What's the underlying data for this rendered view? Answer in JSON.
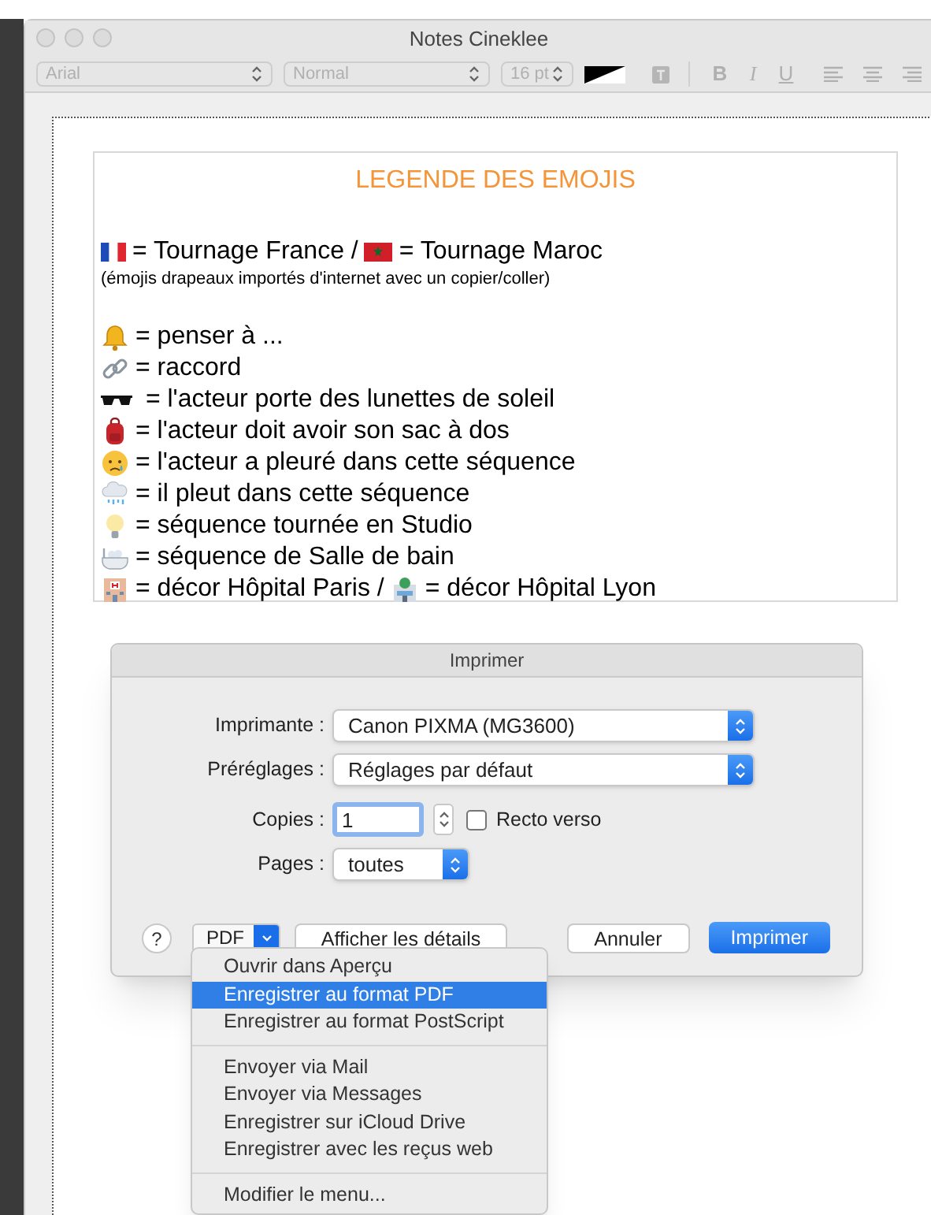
{
  "window": {
    "title": "Notes Cineklee"
  },
  "toolbar": {
    "disabled": true,
    "font": "Arial",
    "style": "Normal",
    "size": "16 pt",
    "buttons": [
      {
        "kind": "bold",
        "label": "B"
      },
      {
        "kind": "italic",
        "label": "I"
      },
      {
        "kind": "underline",
        "label": "U"
      }
    ]
  },
  "legend": {
    "title": "LEGENDE DES EMOJIS",
    "lines": [
      {
        "kind": "big",
        "segments": [
          "= Tournage France /",
          "= Tournage Maroc"
        ]
      },
      {
        "kind": "note",
        "segments": [
          "(émojis drapeaux importés d'internet avec un copier/coller)"
        ]
      },
      {
        "kind": "big",
        "segments": [
          "= penser à ..."
        ]
      },
      {
        "kind": "big",
        "segments": [
          "= raccord"
        ]
      },
      {
        "kind": "big",
        "segments": [
          " = l'acteur porte des lunettes de soleil"
        ]
      },
      {
        "kind": "big",
        "segments": [
          "= l'acteur doit avoir son sac à dos"
        ]
      },
      {
        "kind": "big",
        "segments": [
          "= l'acteur a pleuré dans cette séquence"
        ]
      },
      {
        "kind": "big",
        "segments": [
          "= il pleut dans cette séquence"
        ]
      },
      {
        "kind": "big",
        "segments": [
          "= séquence tournée en Studio"
        ]
      },
      {
        "kind": "big",
        "segments": [
          "= séquence de Salle de bain"
        ]
      },
      {
        "kind": "big",
        "segments": [
          "= décor Hôpital Paris /",
          "= décor Hôpital Lyon"
        ]
      }
    ]
  },
  "print_dialog": {
    "title": "Imprimer",
    "printer": {
      "label": "Imprimante :",
      "value": "Canon PIXMA (MG3600)"
    },
    "presets": {
      "label": "Préréglages :",
      "value": "Réglages par défaut"
    },
    "copies": {
      "label": "Copies :",
      "value": "1"
    },
    "duplex": {
      "label": "Recto verso",
      "checked": false
    },
    "pages": {
      "label": "Pages :",
      "value": "toutes"
    },
    "help": "?",
    "pdf": "PDF",
    "details": "Afficher les détails",
    "cancel": "Annuler",
    "print": "Imprimer"
  },
  "pdf_menu": {
    "groups": [
      [
        {
          "label": "Ouvrir dans Aperçu",
          "selected": false
        },
        {
          "label": "Enregistrer au format PDF",
          "selected": true
        },
        {
          "label": "Enregistrer au format PostScript",
          "selected": false
        }
      ],
      [
        {
          "label": "Envoyer via Mail",
          "selected": false
        },
        {
          "label": "Envoyer via Messages",
          "selected": false
        },
        {
          "label": "Enregistrer sur iCloud Drive",
          "selected": false
        },
        {
          "label": "Enregistrer avec les reçus web",
          "selected": false
        }
      ],
      [
        {
          "label": "Modifier le menu...",
          "selected": false
        }
      ]
    ]
  }
}
